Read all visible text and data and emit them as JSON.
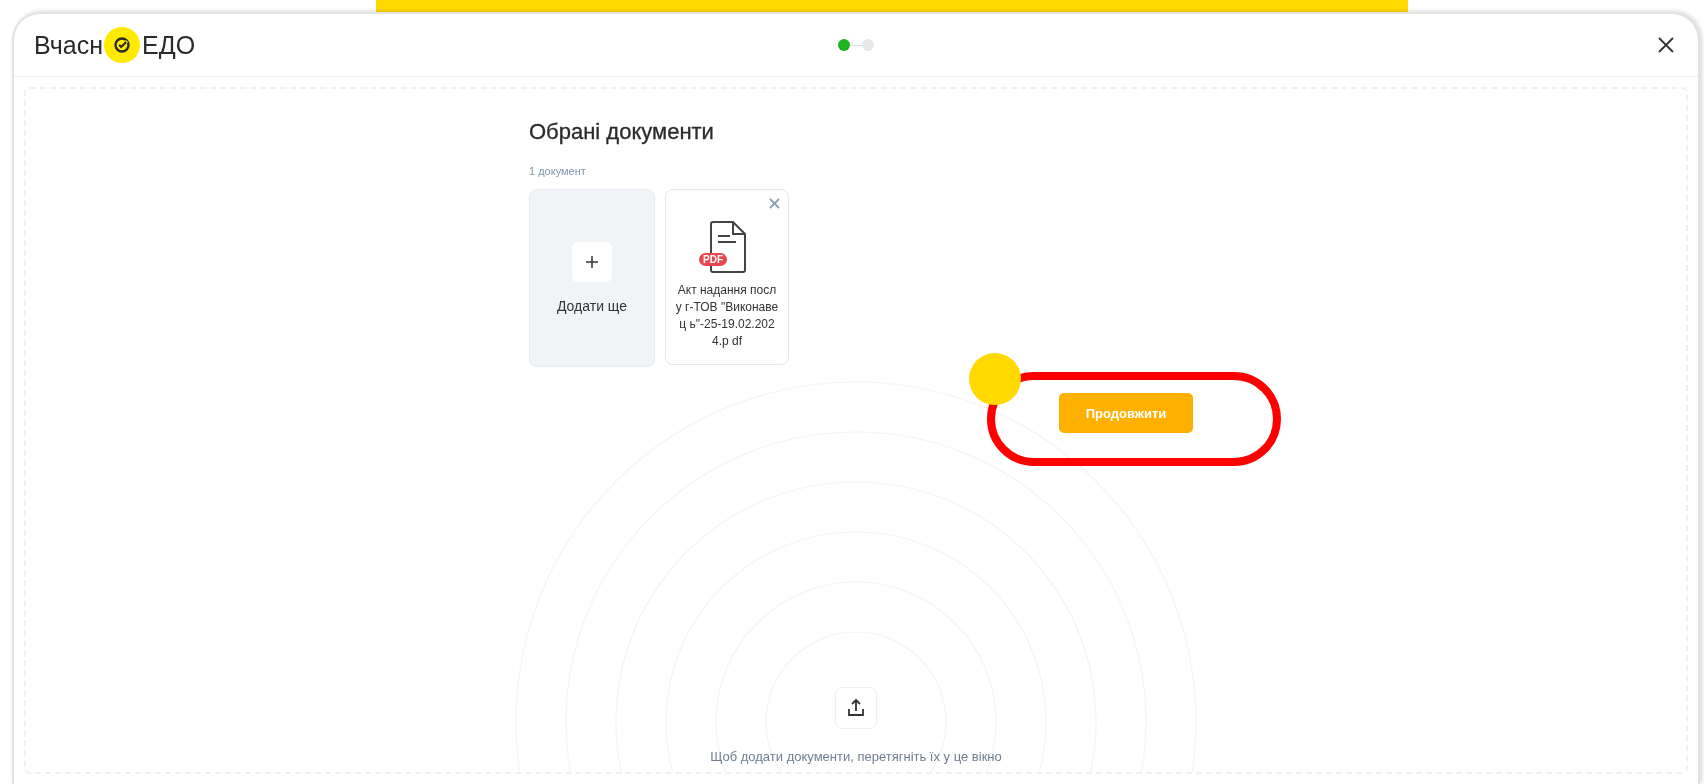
{
  "header": {
    "logo": {
      "before": "Вчасн",
      "after": "ЕДО"
    },
    "steps": [
      {
        "selected": true
      },
      {
        "selected": false
      }
    ]
  },
  "title": "Обрані документи",
  "count": "1 документ",
  "add_card": {
    "label": "Додати ще"
  },
  "files": [
    {
      "name": "Акт надання послу г-ТОВ \"Виконавец ь\"-25-19.02.2024.p df",
      "badge": "PDF"
    }
  ],
  "continue_button": "Продовжити",
  "drop_hint": "Щоб додати документи, перетягніть їх у це вікно"
}
